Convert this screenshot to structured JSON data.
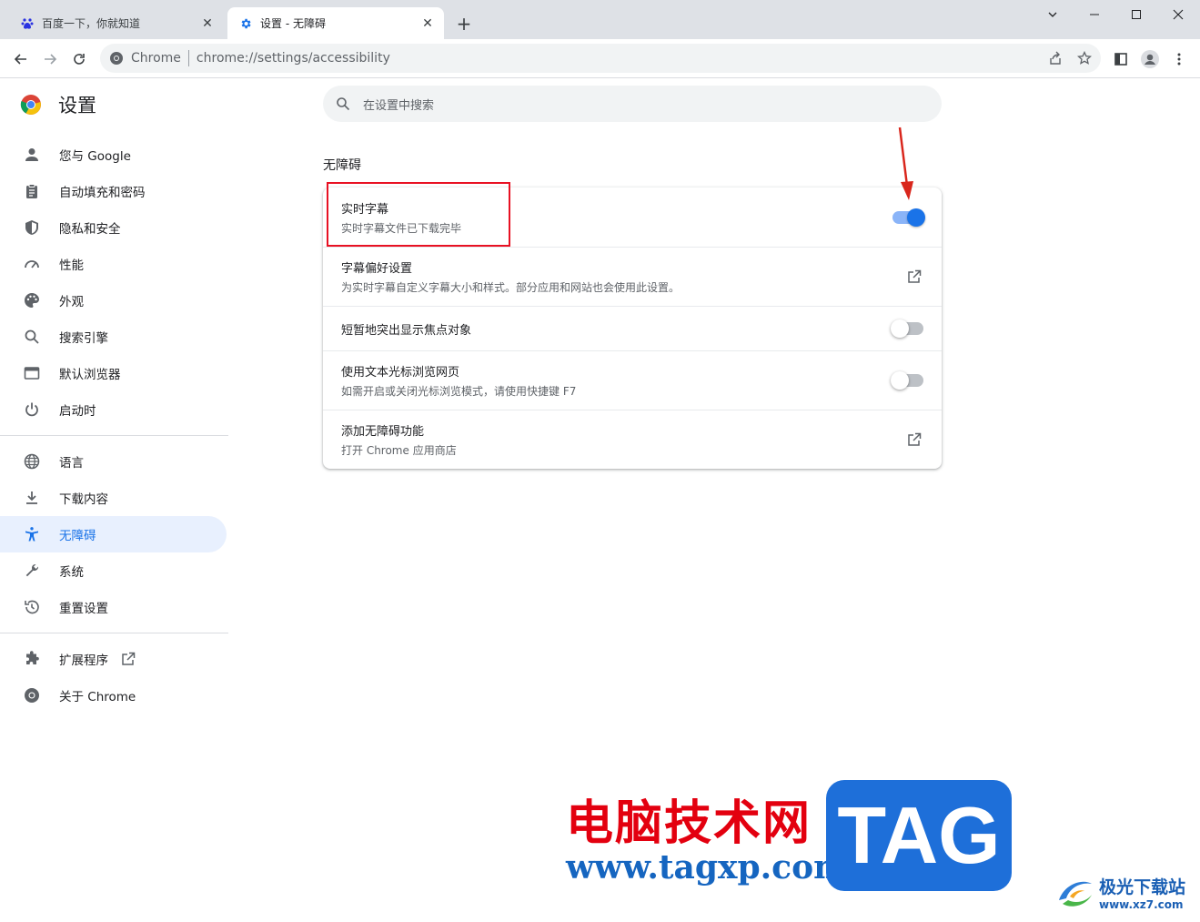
{
  "browser": {
    "tabs": [
      {
        "title": "百度一下，你就知道",
        "icon": "baidu-icon"
      },
      {
        "title": "设置 - 无障碍",
        "icon": "gear-icon"
      }
    ],
    "new_tab_symbol": "+",
    "close_symbol": "✕",
    "omnibox": {
      "site_label": "Chrome",
      "url": "chrome://settings/accessibility"
    }
  },
  "settings": {
    "brand_title": "设置",
    "search_placeholder": "在设置中搜索",
    "nav": [
      {
        "label": "您与 Google",
        "icon": "person-icon"
      },
      {
        "label": "自动填充和密码",
        "icon": "clipboard-icon"
      },
      {
        "label": "隐私和安全",
        "icon": "shield-icon"
      },
      {
        "label": "性能",
        "icon": "speedometer-icon"
      },
      {
        "label": "外观",
        "icon": "palette-icon"
      },
      {
        "label": "搜索引擎",
        "icon": "search-icon"
      },
      {
        "label": "默认浏览器",
        "icon": "browser-window-icon"
      },
      {
        "label": "启动时",
        "icon": "power-icon"
      },
      {
        "label": "语言",
        "icon": "globe-icon"
      },
      {
        "label": "下载内容",
        "icon": "download-icon"
      },
      {
        "label": "无障碍",
        "icon": "accessibility-icon"
      },
      {
        "label": "系统",
        "icon": "wrench-icon"
      },
      {
        "label": "重置设置",
        "icon": "history-icon"
      },
      {
        "label": "扩展程序",
        "icon": "puzzle-icon"
      },
      {
        "label": "关于 Chrome",
        "icon": "chrome-icon"
      }
    ],
    "section_title": "无障碍",
    "rows": [
      {
        "label": "实时字幕",
        "sublabel": "实时字幕文件已下载完毕",
        "control": "toggle",
        "on": true
      },
      {
        "label": "字幕偏好设置",
        "sublabel": "为实时字幕自定义字幕大小和样式。部分应用和网站也会使用此设置。",
        "control": "external-link"
      },
      {
        "label": "短暂地突出显示焦点对象",
        "sublabel": "",
        "control": "toggle",
        "on": false
      },
      {
        "label": "使用文本光标浏览网页",
        "sublabel": "如需开启或关闭光标浏览模式，请使用快捷键 F7",
        "control": "toggle",
        "on": false
      },
      {
        "label": "添加无障碍功能",
        "sublabel": "打开 Chrome 应用商店",
        "control": "external-link"
      }
    ]
  },
  "watermark": {
    "cn_text": "电脑技术网",
    "url_text": "www.tagxp.com",
    "tag_text": "TAG",
    "site_cn": "极光下载站",
    "site_url": "www.xz7.com"
  },
  "colors": {
    "accent": "#1a73e8",
    "annotation": "#e81123"
  }
}
